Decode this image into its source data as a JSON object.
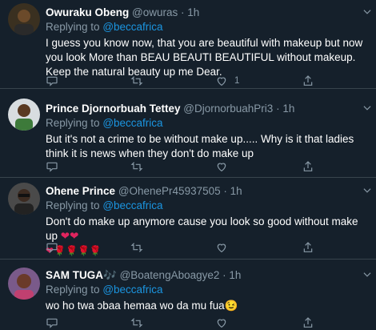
{
  "tweets": [
    {
      "name": "Owuraku Obeng",
      "handle": "@owuras",
      "dot": "·",
      "time": "1h",
      "reply_prefix": "Replying to",
      "reply_to": "@beccafrica",
      "text": "I guess you know now, that you are beautiful with makeup but now you look More than BEAU BEAUTI BEAUTIFUL without makeup. Keep the natural beauty up me Dear.",
      "like_count": "1"
    },
    {
      "name": "Prince Djornorbuah Tettey",
      "handle": "@DjornorbuahPri3",
      "dot": "·",
      "time": "1h",
      "reply_prefix": "Replying to",
      "reply_to": "@beccafrica",
      "text": "But it's not a crime to be without make up..... Why is it that ladies think it is news when they don't do make up"
    },
    {
      "name": "Ohene Prince",
      "handle": "@OhenePr45937505",
      "dot": "·",
      "time": "1h",
      "reply_prefix": "Replying to",
      "reply_to": "@beccafrica",
      "text": "Don't do make up anymore cause you look so good without make up",
      "emoji_hearts": "❤❤",
      "emoji_line2": "❤🌹🌹🌹🌹"
    },
    {
      "name": "SAM TUGA",
      "name_emoji": "🎶",
      "handle": "@BoatengAboagye2",
      "dot": "·",
      "time": "1h",
      "reply_prefix": "Replying to",
      "reply_to": "@beccafrica",
      "text": "wo ho twa ɔbaa hemaa wo da mu fua",
      "text_emoji": "😉"
    }
  ],
  "colors": {
    "background": "#15202b",
    "secondary_text": "#8899a6",
    "link": "#1b95e0",
    "divider": "#38444d"
  },
  "icons": [
    "reply-icon",
    "retweet-icon",
    "like-icon",
    "share-icon",
    "caret-down-icon"
  ]
}
